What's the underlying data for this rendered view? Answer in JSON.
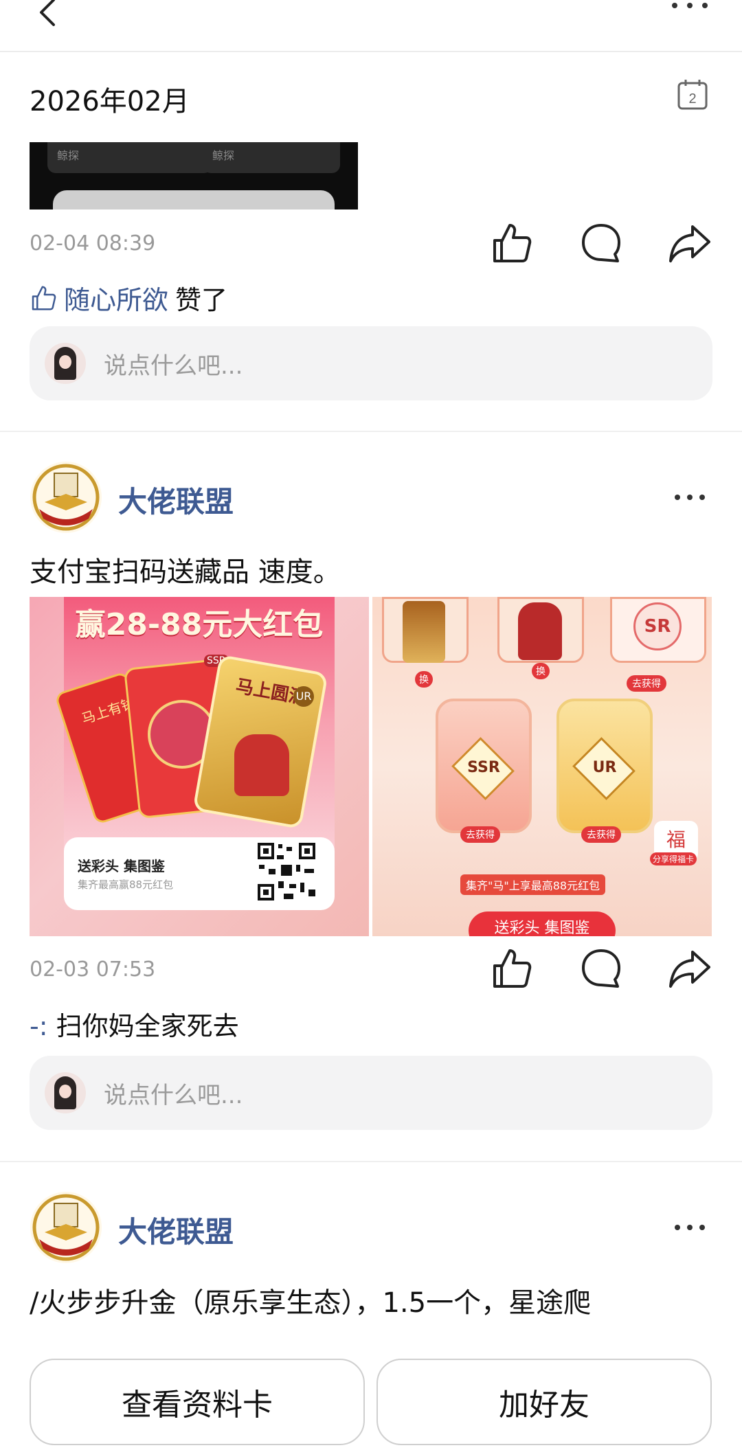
{
  "header": {
    "back_icon": "chevron-left-icon",
    "more_icon": "more-dots-icon"
  },
  "section": {
    "title": "2026年02月",
    "calendar_day": "2"
  },
  "post1": {
    "thumb_labels": [
      "鲸探",
      "鲸探"
    ],
    "time": "02-04 08:39",
    "liker": "随心所欲",
    "liked_suffix": "赞了",
    "comment_placeholder": "说点什么吧..."
  },
  "post2": {
    "author": "大佬联盟",
    "text": "支付宝扫码送藏品 速度。",
    "image1": {
      "headline": "赢28-88元大红包",
      "card_title": "送彩头 集图鉴",
      "card_sub": "集齐最高赢88元红包",
      "red_label": "马上有钱",
      "ssr_tag": "SSR",
      "ur_tag": "UR",
      "gold_label": "马上圆满"
    },
    "image2": {
      "sr": "SR",
      "ssr": "SSR",
      "ur": "UR",
      "go_get": "去获得",
      "obtained": "换",
      "fu": "福",
      "share": "分享得福卡",
      "banner": "集齐\"马\"上享最高88元红包",
      "bottom_btn": "送彩头 集图鉴"
    },
    "time": "02-03 07:53",
    "comment_author": "-:",
    "comment_text": "扫你妈全家死去",
    "comment_placeholder": "说点什么吧..."
  },
  "post3": {
    "author": "大佬联盟",
    "text": "/火步步升金（原乐享生态），1.5一个，星途爬"
  },
  "buttons": {
    "view_card": "查看资料卡",
    "add_friend": "加好友"
  },
  "colors": {
    "link_blue": "#3e5a92",
    "divider": "#efefef",
    "input_bg": "#f3f3f4"
  }
}
